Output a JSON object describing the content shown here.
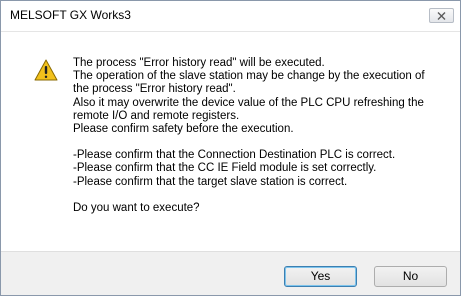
{
  "window": {
    "title": "MELSOFT GX Works3"
  },
  "icons": {
    "close": "close-icon",
    "warning": "warning-icon"
  },
  "message": {
    "lines": [
      "The process \"Error history read\" will be executed.",
      "The operation of the slave station may be change by the execution of",
      "the process \"Error history read\".",
      "Also it may overwrite the device value of the PLC CPU refreshing the",
      "remote I/O and remote registers.",
      "Please confirm safety before the execution."
    ],
    "checks": [
      "-Please confirm that the Connection Destination PLC is correct.",
      "-Please confirm that the CC IE Field module is set correctly.",
      "-Please confirm that the target slave station is correct."
    ],
    "question": "Do you want to execute?"
  },
  "buttons": {
    "yes": "Yes",
    "no": "No"
  },
  "colors": {
    "warning_fill": "#f2c11c",
    "accent_border": "#3c7fb1"
  }
}
